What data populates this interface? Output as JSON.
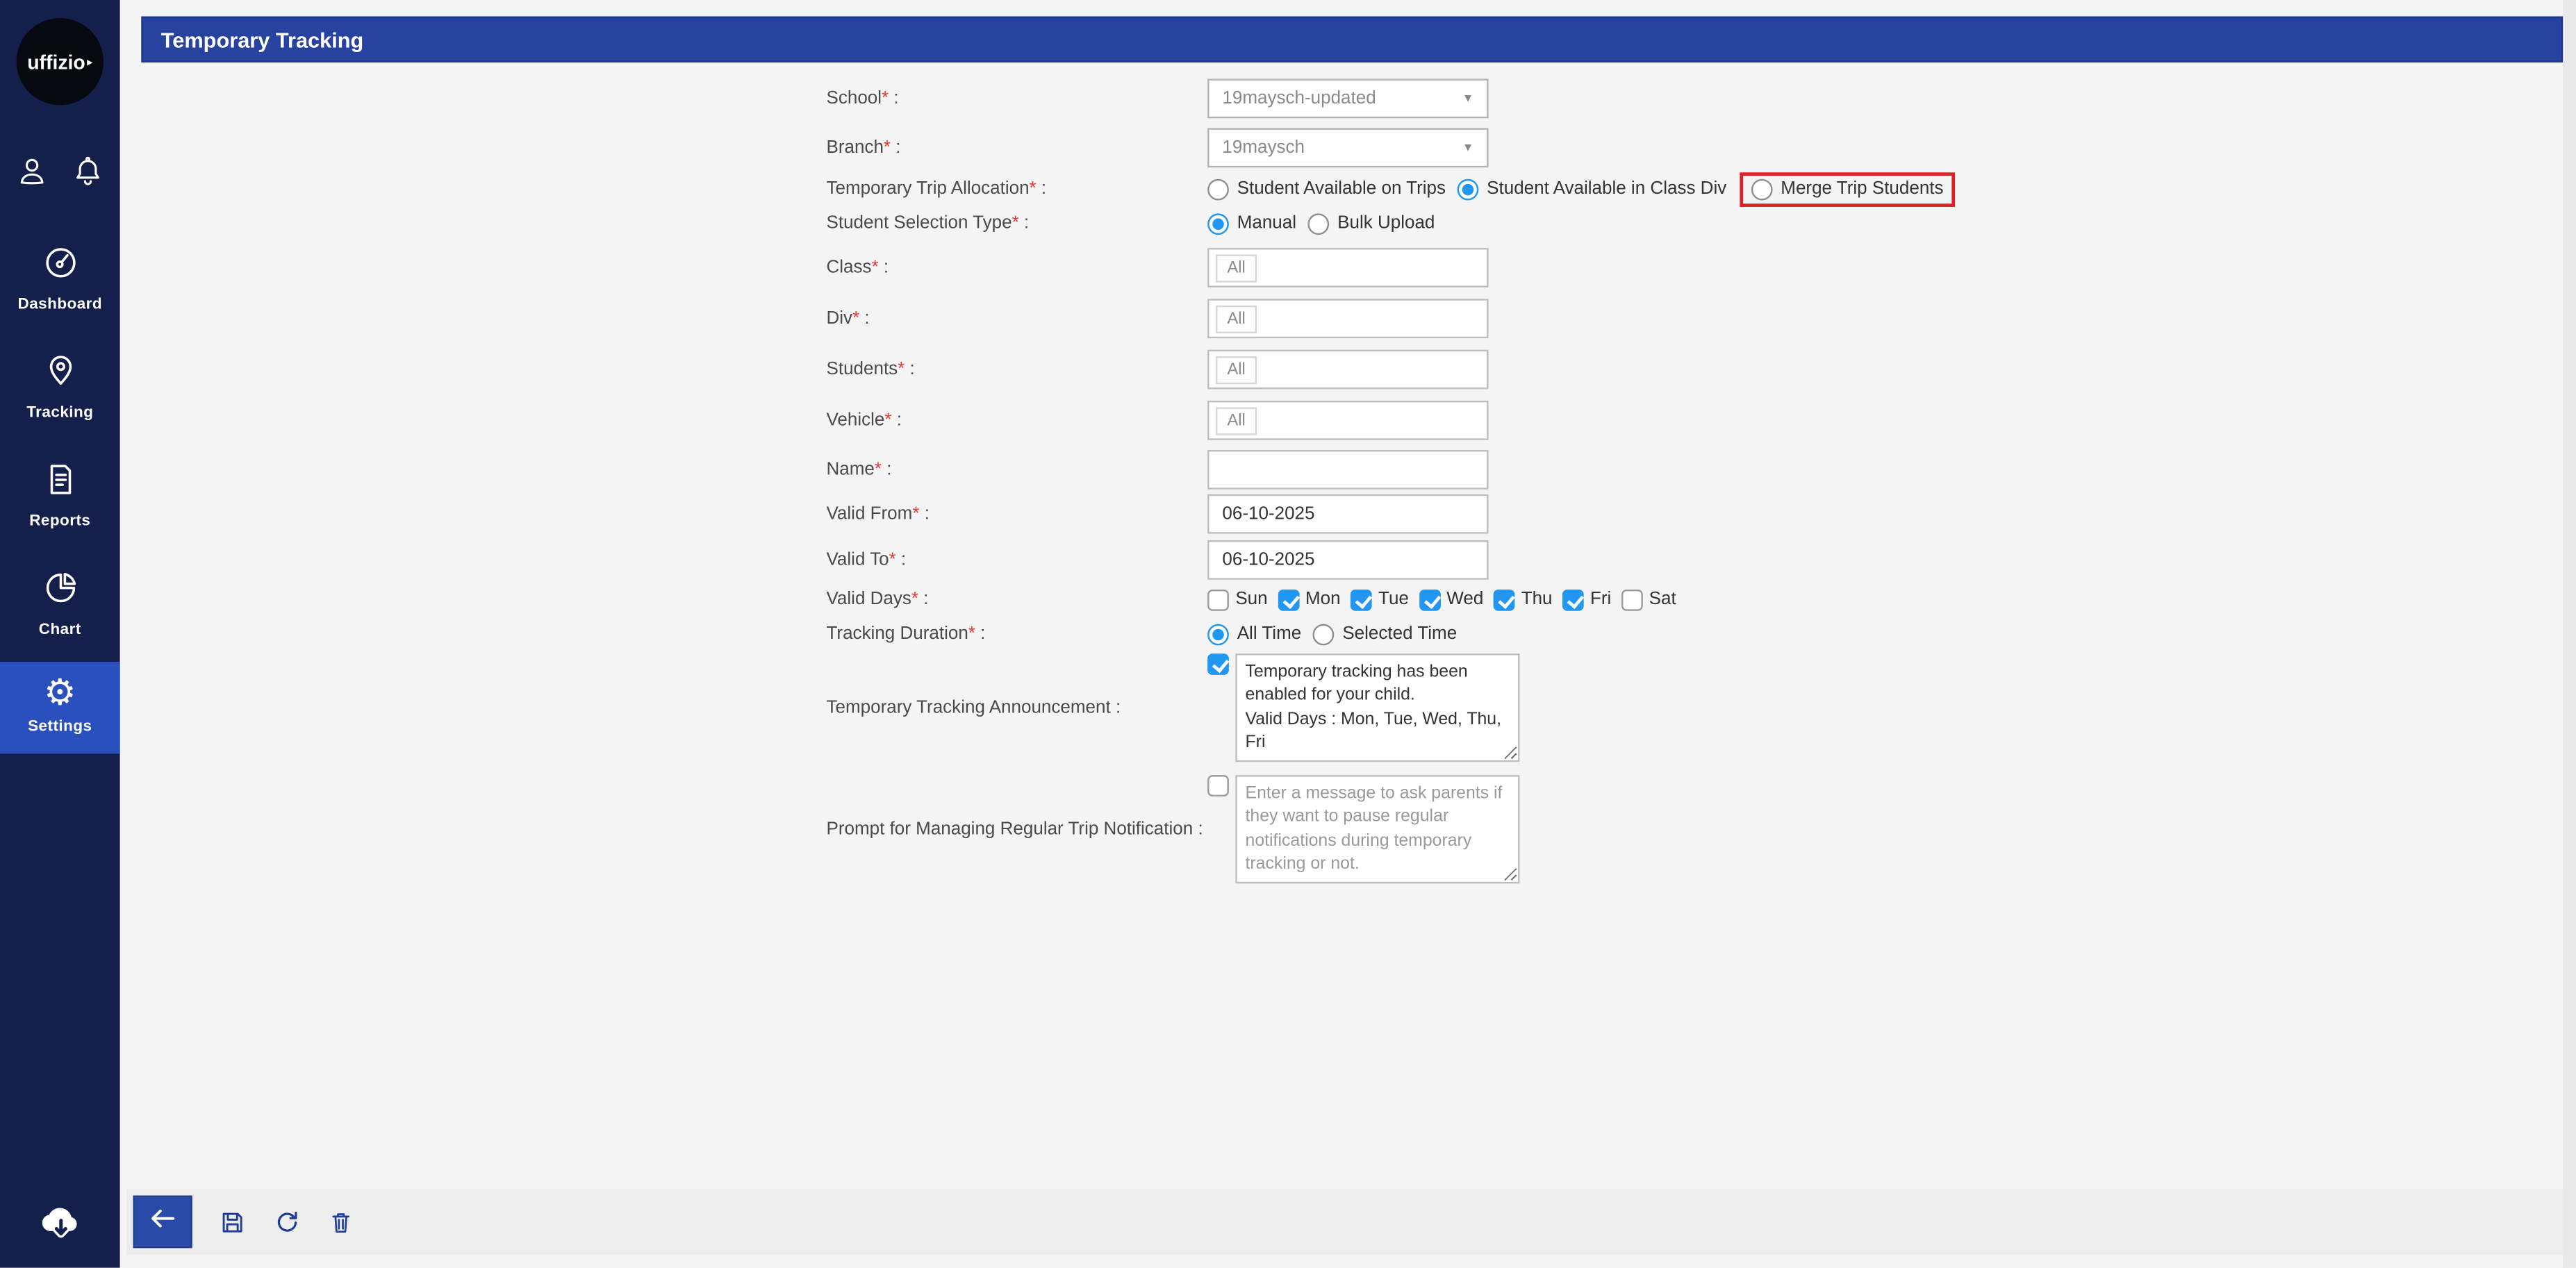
{
  "brand": {
    "logo_text": "uffizio",
    "logo_arrow": "▸"
  },
  "colors": {
    "sidebar": "#151f4c",
    "active_item": "#2a50bd",
    "header_bar": "#27429f",
    "checked_blue": "#2196f3",
    "highlight_red": "#df1f26",
    "back_button": "#2a4aa8"
  },
  "header": {
    "title": "Temporary Tracking"
  },
  "sidebar": {
    "items": [
      {
        "label": "Dashboard",
        "active": false
      },
      {
        "label": "Tracking",
        "active": false
      },
      {
        "label": "Reports",
        "active": false
      },
      {
        "label": "Chart",
        "active": false
      },
      {
        "label": "Settings",
        "active": true
      }
    ]
  },
  "marks": {
    "req": "*",
    "colon": " :"
  },
  "select_caret": "▼",
  "form": {
    "school": {
      "label": "School",
      "value": "19maysch-updated"
    },
    "branch": {
      "label": "Branch",
      "value": "19maysch"
    },
    "trip_allocation": {
      "label": "Temporary Trip Allocation",
      "options": [
        {
          "label": "Student Available on Trips",
          "selected": false,
          "highlighted": false
        },
        {
          "label": "Student Available in Class Div",
          "selected": true,
          "highlighted": false
        },
        {
          "label": "Merge Trip Students",
          "selected": false,
          "highlighted": true
        }
      ]
    },
    "selection_type": {
      "label": "Student Selection Type",
      "options": [
        {
          "label": "Manual",
          "selected": true
        },
        {
          "label": "Bulk Upload",
          "selected": false
        }
      ]
    },
    "class": {
      "label": "Class",
      "tag": "All"
    },
    "div": {
      "label": "Div",
      "tag": "All"
    },
    "students": {
      "label": "Students",
      "tag": "All"
    },
    "vehicle": {
      "label": "Vehicle",
      "tag": "All"
    },
    "name": {
      "label": "Name",
      "value": ""
    },
    "valid_from": {
      "label": "Valid From",
      "value": "06-10-2025"
    },
    "valid_to": {
      "label": "Valid To",
      "value": "06-10-2025"
    },
    "valid_days": {
      "label": "Valid Days",
      "options": [
        {
          "label": "Sun",
          "checked": false
        },
        {
          "label": "Mon",
          "checked": true
        },
        {
          "label": "Tue",
          "checked": true
        },
        {
          "label": "Wed",
          "checked": true
        },
        {
          "label": "Thu",
          "checked": true
        },
        {
          "label": "Fri",
          "checked": true
        },
        {
          "label": "Sat",
          "checked": false
        }
      ]
    },
    "tracking_duration": {
      "label": "Tracking Duration",
      "options": [
        {
          "label": "All Time",
          "selected": true
        },
        {
          "label": "Selected Time",
          "selected": false
        }
      ]
    },
    "announcement": {
      "label": "Temporary Tracking Announcement",
      "checked": true,
      "value": "Temporary tracking has been enabled for your child.\nValid Days : Mon, Tue, Wed, Thu, Fri"
    },
    "prompt": {
      "label": "Prompt for Managing Regular Trip Notification",
      "checked": false,
      "placeholder": "Enter a message to ask parents if they want to pause regular notifications during temporary tracking or not."
    }
  }
}
